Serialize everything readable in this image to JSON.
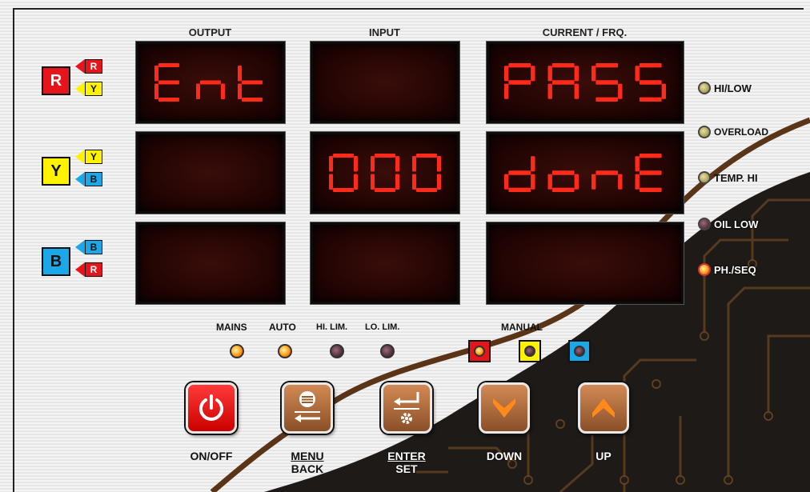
{
  "headers": {
    "output": "OUTPUT",
    "input": "INPUT",
    "current": "CURRENT / FRQ."
  },
  "phases": [
    {
      "main": "R",
      "top": "R",
      "bottom": "Y"
    },
    {
      "main": "Y",
      "top": "Y",
      "bottom": "B"
    },
    {
      "main": "B",
      "top": "B",
      "bottom": "R"
    }
  ],
  "displays": [
    [
      "Ent",
      "",
      "PASS"
    ],
    [
      "",
      "000",
      "donE"
    ],
    [
      "",
      "",
      ""
    ]
  ],
  "side_indicators": [
    {
      "label": "HI/LOW",
      "state": "olive"
    },
    {
      "label": "OVERLOAD",
      "state": "olive"
    },
    {
      "label": "TEMP. HI",
      "state": "olive"
    },
    {
      "label": "OIL LOW",
      "state": "dark"
    },
    {
      "label": "PH./SEQ",
      "state": "lit"
    }
  ],
  "status": {
    "mains": "MAINS",
    "auto": "AUTO",
    "hi_lim": "HI. LIM.",
    "lo_lim": "LO. LIM.",
    "manual": "MANUAL"
  },
  "status_leds": {
    "mains": "on",
    "auto": "on",
    "hi_lim": "off",
    "lo_lim": "off"
  },
  "manual_leds": [
    {
      "phase": "R",
      "state": "on"
    },
    {
      "phase": "Y",
      "state": "off"
    },
    {
      "phase": "B",
      "state": "off"
    }
  ],
  "buttons": {
    "onoff": "ON/OFF",
    "menu": "MENU",
    "back": "BACK",
    "enter": "ENTER",
    "set": "SET",
    "down": "DOWN",
    "up": "UP"
  },
  "colors": {
    "red": "#e8141c",
    "yellow": "#fff200",
    "blue": "#1aa8e8",
    "segment": "#ff2a1a",
    "brown_curve": "#5a3416",
    "dark_bg": "#1e1a18"
  }
}
